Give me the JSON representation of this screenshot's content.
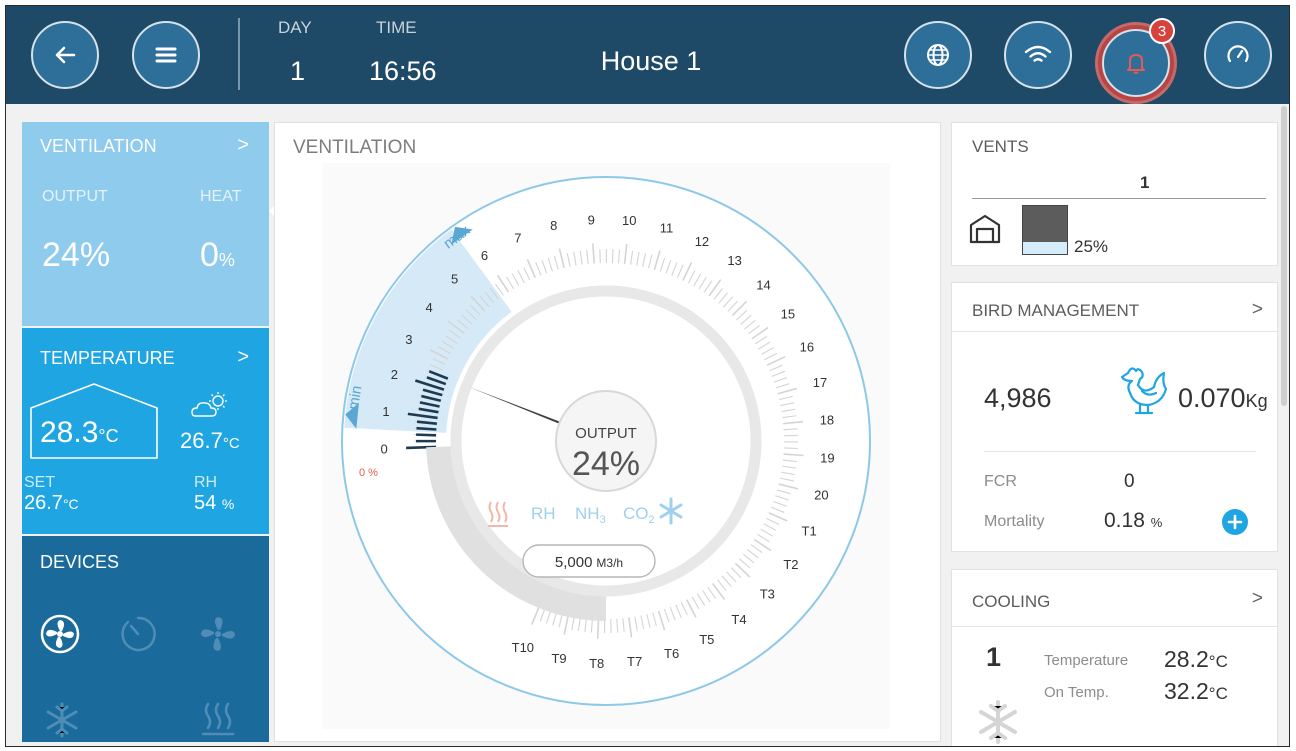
{
  "header": {
    "day_label": "DAY",
    "day_value": "1",
    "time_label": "TIME",
    "time_value": "16:56",
    "title": "House 1",
    "alarm_count": "3",
    "icons": [
      "back-arrow-icon",
      "menu-icon",
      "globe-icon",
      "wifi-icon",
      "bell-icon",
      "gauge-icon"
    ]
  },
  "ventilation_tile": {
    "title": "VENTILATION",
    "arrow": ">",
    "output_label": "OUTPUT",
    "heat_label": "HEAT",
    "output_value": "24%",
    "heat_value": "0",
    "heat_unit": "%"
  },
  "temperature_tile": {
    "title": "TEMPERATURE",
    "arrow": ">",
    "inside_value": "28.3",
    "inside_unit": "°C",
    "outside_value": "26.7",
    "outside_unit": "°C",
    "set_label": "SET",
    "set_value": "26.7",
    "set_unit": "°C",
    "rh_label": "RH",
    "rh_value": "54",
    "rh_unit": "%"
  },
  "devices_tile": {
    "title": "DEVICES",
    "icons": [
      "fan-icon",
      "timer-icon",
      "fan-off-icon",
      "snowflake-icon",
      "heater-icon"
    ]
  },
  "center": {
    "title": "VENTILATION",
    "dial": {
      "min_label": "min",
      "max_label": "max",
      "zero_percent": "0 %",
      "output_label": "OUTPUT",
      "output_value": "24%",
      "indicators": [
        "RH",
        "NH",
        "CO"
      ],
      "airflow": "5,000",
      "airflow_unit": "M3/h",
      "level_labels": [
        "0",
        "1",
        "2",
        "3",
        "4",
        "5",
        "6",
        "7",
        "8",
        "9",
        "10",
        "11",
        "12",
        "13",
        "14",
        "15",
        "16",
        "17",
        "18",
        "19",
        "20",
        "T1",
        "T2",
        "T3",
        "T4",
        "T5",
        "T6",
        "T7",
        "T8",
        "T9",
        "T10"
      ],
      "current_level": 2.4,
      "min_level": 1,
      "max_level": 6,
      "accent": "#1fa5e2"
    }
  },
  "vents_card": {
    "title": "VENTS",
    "vent_number": "1",
    "vent_value": "25%",
    "vent_level": 0.25
  },
  "bird_card": {
    "title": "BIRD MANAGEMENT",
    "arrow": ">",
    "count": "4,986",
    "weight": "0.070",
    "weight_unit": "Kg",
    "fcr_label": "FCR",
    "fcr_value": "0",
    "mortality_label": "Mortality",
    "mortality_value": "0.18",
    "mortality_unit": "%"
  },
  "cooling_card": {
    "title": "COOLING",
    "arrow": ">",
    "number": "1",
    "temp_label": "Temperature",
    "temp_value": "28.2",
    "temp_unit": "°C",
    "ontemp_label": "On Temp.",
    "ontemp_value": "32.2",
    "ontemp_unit": "°C"
  }
}
